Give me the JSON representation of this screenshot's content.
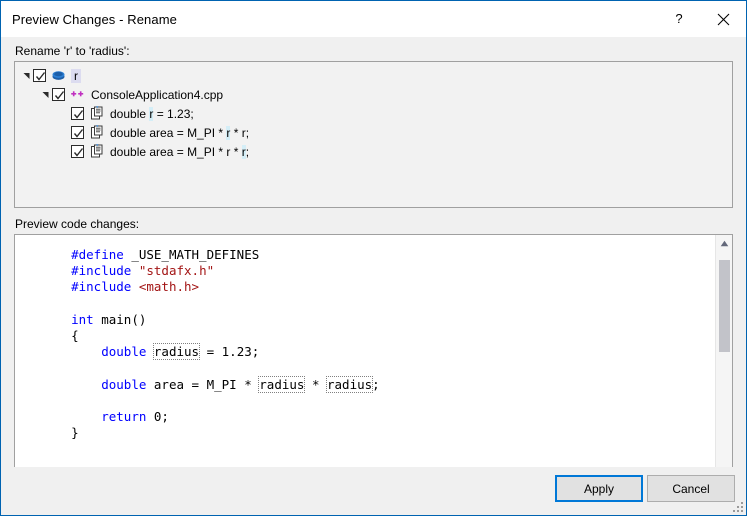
{
  "window": {
    "title": "Preview Changes - Rename",
    "help_button": "?",
    "close_button": "✕",
    "accent_color": "#0063b1"
  },
  "labels": {
    "rename_header": "Rename 'r' to 'radius':",
    "preview_header": "Preview code changes:"
  },
  "tree": {
    "root": {
      "label": "r",
      "icon": "solution-icon",
      "checked": true,
      "expanded": true,
      "selected": true
    },
    "file": {
      "label": "ConsoleApplication4.cpp",
      "icon": "cpp-file-icon",
      "checked": true,
      "expanded": true
    },
    "occurrences": [
      {
        "icon": "code-reference-icon",
        "checked": true,
        "parts": [
          {
            "text": "double ",
            "highlight": false
          },
          {
            "text": "r",
            "highlight": true
          },
          {
            "text": " = 1.23;",
            "highlight": false
          }
        ]
      },
      {
        "icon": "code-reference-icon",
        "checked": true,
        "parts": [
          {
            "text": "double area = M_PI * ",
            "highlight": false
          },
          {
            "text": "r",
            "highlight": true
          },
          {
            "text": " * r;",
            "highlight": false
          }
        ]
      },
      {
        "icon": "code-reference-icon",
        "checked": true,
        "parts": [
          {
            "text": "double area = M_PI * r * ",
            "highlight": false
          },
          {
            "text": "r",
            "highlight": true
          },
          {
            "text": ";",
            "highlight": false
          }
        ]
      }
    ]
  },
  "code": {
    "lines": [
      [
        {
          "t": "    ",
          "c": "plain"
        },
        {
          "t": "#define",
          "c": "pp"
        },
        {
          "t": " _USE_MATH_DEFINES",
          "c": "plain"
        }
      ],
      [
        {
          "t": "    ",
          "c": "plain"
        },
        {
          "t": "#include",
          "c": "pp"
        },
        {
          "t": " ",
          "c": "plain"
        },
        {
          "t": "\"stdafx.h\"",
          "c": "str"
        }
      ],
      [
        {
          "t": "    ",
          "c": "plain"
        },
        {
          "t": "#include",
          "c": "pp"
        },
        {
          "t": " ",
          "c": "plain"
        },
        {
          "t": "<math.h>",
          "c": "str"
        }
      ],
      [],
      [
        {
          "t": "    ",
          "c": "plain"
        },
        {
          "t": "int",
          "c": "kw"
        },
        {
          "t": " main()",
          "c": "plain"
        }
      ],
      [
        {
          "t": "    {",
          "c": "plain"
        }
      ],
      [
        {
          "t": "        ",
          "c": "plain"
        },
        {
          "t": "double",
          "c": "kw"
        },
        {
          "t": " ",
          "c": "plain"
        },
        {
          "t": "radius",
          "c": "renamed"
        },
        {
          "t": " = 1.23;",
          "c": "plain"
        }
      ],
      [],
      [
        {
          "t": "        ",
          "c": "plain"
        },
        {
          "t": "double",
          "c": "kw"
        },
        {
          "t": " area = M_PI * ",
          "c": "plain"
        },
        {
          "t": "radius",
          "c": "renamed"
        },
        {
          "t": " * ",
          "c": "plain"
        },
        {
          "t": "radius",
          "c": "renamed"
        },
        {
          "t": ";",
          "c": "plain"
        }
      ],
      [],
      [
        {
          "t": "        ",
          "c": "plain"
        },
        {
          "t": "return",
          "c": "kw"
        },
        {
          "t": " 0;",
          "c": "plain"
        }
      ],
      [
        {
          "t": "    }",
          "c": "plain"
        }
      ]
    ]
  },
  "scrollbars": {
    "vertical": {
      "up_arrow": "▲",
      "down_arrow": "▼"
    },
    "horizontal": {
      "left_arrow": "◀",
      "right_arrow": "▶"
    }
  },
  "buttons": {
    "apply": "Apply",
    "cancel": "Cancel"
  }
}
